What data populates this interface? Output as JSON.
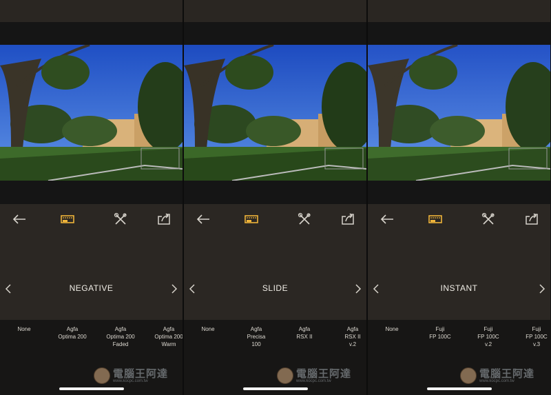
{
  "colors": {
    "accent": "#f0b53a",
    "icon": "#d8d4cc",
    "background": "#2a2622",
    "filter_strip": "#171615"
  },
  "icons": {
    "back": "arrow-left-icon",
    "film": "film-frame-icon",
    "tools": "wrench-screwdriver-icon",
    "share": "share-icon",
    "prev": "chevron-left-icon",
    "next": "chevron-right-icon"
  },
  "panels": [
    {
      "category": "NEGATIVE",
      "filters": [
        "None",
        "Agfa\nOptima 200",
        "Agfa\nOptima 200\nFaded",
        "Agfa\nOptima 200\nWarm"
      ]
    },
    {
      "category": "SLIDE",
      "filters": [
        "None",
        "Agfa\nPrecisa\n100",
        "Agfa\nRSX II",
        "Agfa\nRSX II\nv.2"
      ]
    },
    {
      "category": "INSTANT",
      "filters": [
        "None",
        "Fuji\nFP 100C",
        "Fuji\nFP 100C\nv.2",
        "Fuji\nFP 100C\nv.3"
      ]
    }
  ],
  "watermark": {
    "text": "電腦王阿達",
    "url": "www.kocpc.com.tw"
  }
}
